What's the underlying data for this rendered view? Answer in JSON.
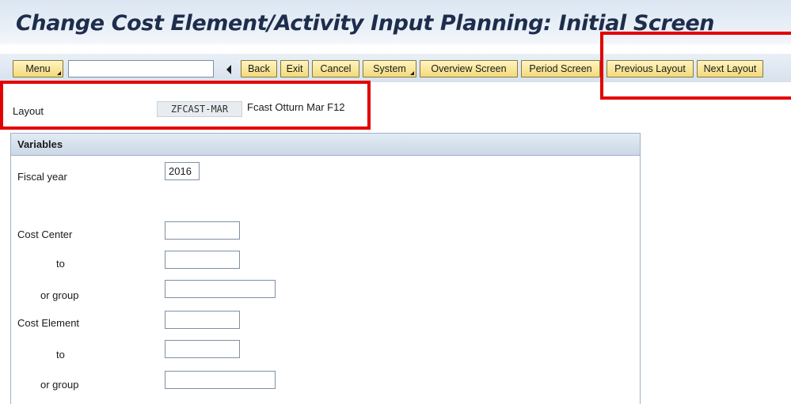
{
  "window": {
    "title": "Change Cost Element/Activity Input Planning: Initial Screen"
  },
  "toolbar": {
    "menu_label": "Menu",
    "command_value": "",
    "back_label": "Back",
    "exit_label": "Exit",
    "cancel_label": "Cancel",
    "system_label": "System",
    "overview_label": "Overview Screen",
    "period_label": "Period Screen",
    "previous_layout_label": "Previous Layout",
    "next_layout_label": "Next Layout"
  },
  "layout": {
    "label": "Layout",
    "value": "ZFCAST-MAR",
    "description": "Fcast Otturn Mar F12"
  },
  "variables": {
    "title": "Variables",
    "fiscal_year_label": "Fiscal year",
    "fiscal_year_value": "2016",
    "cost_center_label": "Cost Center",
    "cost_center_from": "",
    "cost_center_to_label": "to",
    "cost_center_to": "",
    "cost_center_group_label": "or group",
    "cost_center_group": "",
    "cost_element_label": "Cost Element",
    "cost_element_from": "",
    "cost_element_to_label": "to",
    "cost_element_to": "",
    "cost_element_group_label": "or group",
    "cost_element_group": ""
  },
  "colors": {
    "highlight": "#e30000",
    "button_fill": "#f3d97a",
    "title_text": "#1e2d4c"
  }
}
